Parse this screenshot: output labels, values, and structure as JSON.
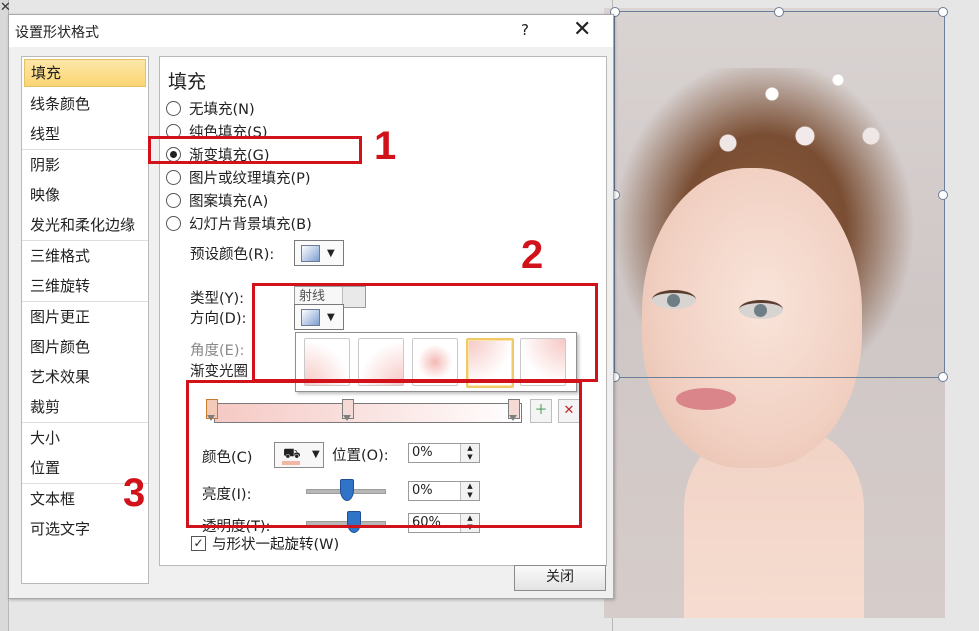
{
  "dialog": {
    "title": "设置形状格式",
    "help": "?",
    "close_x": "✕",
    "close_button": "关闭"
  },
  "nav": [
    "填充",
    "线条颜色",
    "线型",
    "阴影",
    "映像",
    "发光和柔化边缘",
    "三维格式",
    "三维旋转",
    "图片更正",
    "图片颜色",
    "艺术效果",
    "裁剪",
    "大小",
    "位置",
    "文本框",
    "可选文字"
  ],
  "fill": {
    "title": "填充",
    "options": [
      "无填充(N)",
      "纯色填充(S)",
      "渐变填充(G)",
      "图片或纹理填充(P)",
      "图案填充(A)",
      "幻灯片背景填充(B)"
    ],
    "selected_index": 2,
    "preset_label": "预设颜色(R):",
    "type_label": "类型(Y):",
    "type_value": "射线",
    "direction_label": "方向(D):",
    "angle_label": "角度(E):",
    "stops_label": "渐变光圈",
    "color_label": "颜色(C)",
    "position_label": "位置(O):",
    "position_value": "0%",
    "brightness_label": "亮度(I):",
    "brightness_value": "0%",
    "transparency_label": "透明度(T):",
    "transparency_value": "60%",
    "rotate_label": "与形状一起旋转(W)",
    "rotate_checked": "✓"
  },
  "annotations": [
    "1",
    "2",
    "3"
  ],
  "colors": {
    "annotation_red": "#d1121a",
    "nav_active": "#fbd573",
    "slider_thumb": "#2f74c9"
  },
  "icons": {
    "add_stop": "add-gradient-stop-icon",
    "remove_stop": "remove-gradient-stop-icon",
    "fill_bucket": "paint-bucket-icon",
    "bg_close": "close-icon"
  },
  "bg": {
    "x": "✕"
  }
}
